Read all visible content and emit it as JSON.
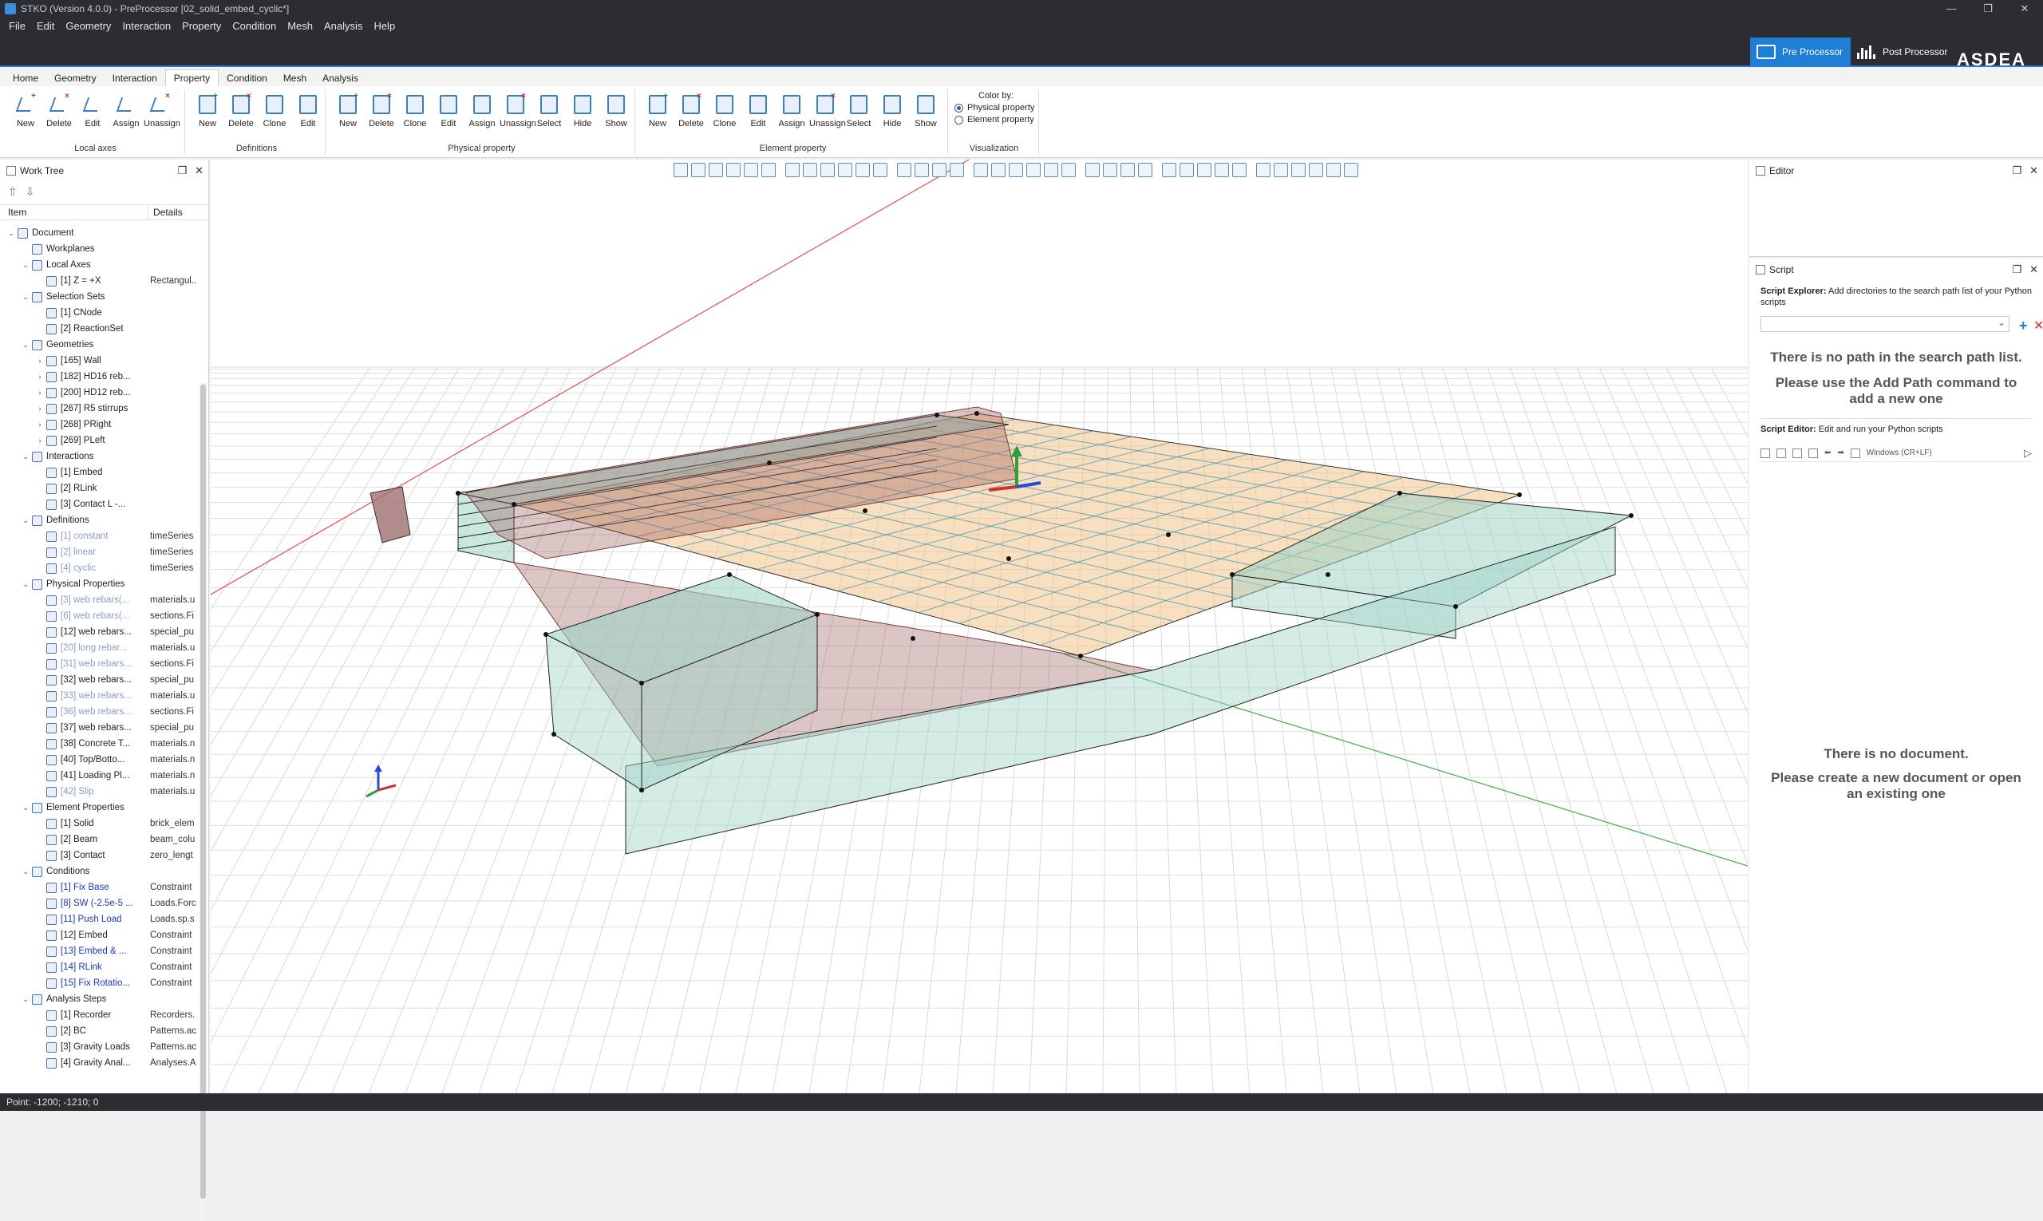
{
  "window": {
    "title": "STKO (Version 4.0.0) - PreProcessor [02_solid_embed_cyclic*]",
    "controls": [
      "—",
      "❐",
      "✕"
    ]
  },
  "menu": [
    "File",
    "Edit",
    "Geometry",
    "Interaction",
    "Property",
    "Condition",
    "Mesh",
    "Analysis",
    "Help"
  ],
  "modes": {
    "pre": "Pre Processor",
    "post": "Post Processor"
  },
  "brand": "ASDEA",
  "ribbon": {
    "tabs": [
      "Home",
      "Geometry",
      "Interaction",
      "Property",
      "Condition",
      "Mesh",
      "Analysis"
    ],
    "active_tab": "Property",
    "groups": [
      {
        "name": "Local axes",
        "buttons": [
          "New",
          "Delete",
          "Edit",
          "Assign",
          "Unassign"
        ]
      },
      {
        "name": "Definitions",
        "buttons": [
          "New",
          "Delete",
          "Clone",
          "Edit"
        ]
      },
      {
        "name": "Physical property",
        "buttons": [
          "New",
          "Delete",
          "Clone",
          "Edit",
          "Assign",
          "Unassign",
          "Select",
          "Hide",
          "Show"
        ]
      },
      {
        "name": "Element property",
        "buttons": [
          "New",
          "Delete",
          "Clone",
          "Edit",
          "Assign",
          "Unassign",
          "Select",
          "Hide",
          "Show"
        ]
      }
    ],
    "color_by": {
      "title": "Color by:",
      "options": [
        "Physical property",
        "Element property"
      ],
      "selected": "Physical property",
      "group_name": "Visualization"
    }
  },
  "worktree": {
    "title": "Work Tree",
    "col_item": "Item",
    "col_details": "Details",
    "rows": [
      {
        "label": "Document",
        "details": "",
        "level": 0,
        "state": ""
      },
      {
        "label": "Workplanes",
        "details": "",
        "level": 1,
        "state": ""
      },
      {
        "label": "Local Axes",
        "details": "",
        "level": 1,
        "state": ""
      },
      {
        "label": "[1] Z = +X",
        "details": "Rectangul...",
        "level": 2,
        "state": ""
      },
      {
        "label": "Selection Sets",
        "details": "",
        "level": 1,
        "state": ""
      },
      {
        "label": "[1] CNode",
        "details": "",
        "level": 2,
        "state": ""
      },
      {
        "label": "[2] ReactionSet",
        "details": "",
        "level": 2,
        "state": ""
      },
      {
        "label": "Geometries",
        "details": "",
        "level": 1,
        "state": ""
      },
      {
        "label": "[165] Wall",
        "details": "",
        "level": 2,
        "state": ""
      },
      {
        "label": "[182] HD16 reb...",
        "details": "",
        "level": 2,
        "state": ""
      },
      {
        "label": "[200] HD12 reb...",
        "details": "",
        "level": 2,
        "state": ""
      },
      {
        "label": "[267] R5 stirrups",
        "details": "",
        "level": 2,
        "state": ""
      },
      {
        "label": "[268] PRight",
        "details": "",
        "level": 2,
        "state": ""
      },
      {
        "label": "[269] PLeft",
        "details": "",
        "level": 2,
        "state": ""
      },
      {
        "label": "Interactions",
        "details": "",
        "level": 1,
        "state": ""
      },
      {
        "label": "[1] Embed",
        "details": "",
        "level": 2,
        "state": ""
      },
      {
        "label": "[2] RLink",
        "details": "",
        "level": 2,
        "state": ""
      },
      {
        "label": "[3] Contact L -...",
        "details": "",
        "level": 2,
        "state": ""
      },
      {
        "label": "Definitions",
        "details": "",
        "level": 1,
        "state": ""
      },
      {
        "label": "[1] constant",
        "details": "timeSeries",
        "level": 2,
        "state": "grey"
      },
      {
        "label": "[2] linear",
        "details": "timeSeries",
        "level": 2,
        "state": "grey"
      },
      {
        "label": "[4] cyclic",
        "details": "timeSeries",
        "level": 2,
        "state": "grey"
      },
      {
        "label": "Physical Properties",
        "details": "",
        "level": 1,
        "state": ""
      },
      {
        "label": "[3] web rebars(...",
        "details": "materials.u",
        "level": 2,
        "state": "grey"
      },
      {
        "label": "[6] web rebars(...",
        "details": "sections.Fi",
        "level": 2,
        "state": "grey"
      },
      {
        "label": "[12] web rebars...",
        "details": "special_pu",
        "level": 2,
        "state": ""
      },
      {
        "label": "[20] long rebar...",
        "details": "materials.u",
        "level": 2,
        "state": "grey"
      },
      {
        "label": "[31] web rebars...",
        "details": "sections.Fi",
        "level": 2,
        "state": "grey"
      },
      {
        "label": "[32] web rebars...",
        "details": "special_pu",
        "level": 2,
        "state": ""
      },
      {
        "label": "[33] web rebars...",
        "details": "materials.u",
        "level": 2,
        "state": "grey"
      },
      {
        "label": "[36] web rebars...",
        "details": "sections.Fi",
        "level": 2,
        "state": "grey"
      },
      {
        "label": "[37] web rebars...",
        "details": "special_pu",
        "level": 2,
        "state": ""
      },
      {
        "label": "[38] Concrete T...",
        "details": "materials.n",
        "level": 2,
        "state": ""
      },
      {
        "label": "[40] Top/Botto...",
        "details": "materials.n",
        "level": 2,
        "state": ""
      },
      {
        "label": "[41] Loading Pl...",
        "details": "materials.n",
        "level": 2,
        "state": ""
      },
      {
        "label": "[42] Slip",
        "details": "materials.u",
        "level": 2,
        "state": "grey"
      },
      {
        "label": "Element Properties",
        "details": "",
        "level": 1,
        "state": ""
      },
      {
        "label": "[1] Solid",
        "details": "brick_elem",
        "level": 2,
        "state": ""
      },
      {
        "label": "[2] Beam",
        "details": "beam_colu",
        "level": 2,
        "state": ""
      },
      {
        "label": "[3] Contact",
        "details": "zero_lengt",
        "level": 2,
        "state": ""
      },
      {
        "label": "Conditions",
        "details": "",
        "level": 1,
        "state": ""
      },
      {
        "label": "[1] Fix Base",
        "details": "Constraint",
        "level": 2,
        "state": "blue"
      },
      {
        "label": "[8] SW (-2.5e-5 ...",
        "details": "Loads.Forc",
        "level": 2,
        "state": "blue"
      },
      {
        "label": "[11] Push Load",
        "details": "Loads.sp.s",
        "level": 2,
        "state": "blue"
      },
      {
        "label": "[12] Embed",
        "details": "Constraint",
        "level": 2,
        "state": ""
      },
      {
        "label": "[13] Embed & ...",
        "details": "Constraint",
        "level": 2,
        "state": "blue"
      },
      {
        "label": "[14] RLink",
        "details": "Constraint",
        "level": 2,
        "state": "blue"
      },
      {
        "label": "[15] Fix Rotatio...",
        "details": "Constraint",
        "level": 2,
        "state": "blue"
      },
      {
        "label": "Analysis Steps",
        "details": "",
        "level": 1,
        "state": ""
      },
      {
        "label": "[1] Recorder",
        "details": "Recorders.",
        "level": 2,
        "state": ""
      },
      {
        "label": "[2] BC",
        "details": "Patterns.ac",
        "level": 2,
        "state": ""
      },
      {
        "label": "[3] Gravity Loads",
        "details": "Patterns.ac",
        "level": 2,
        "state": ""
      },
      {
        "label": "[4] Gravity Anal...",
        "details": "Analyses.A",
        "level": 2,
        "state": ""
      }
    ]
  },
  "editor": {
    "title": "Editor"
  },
  "script": {
    "title": "Script",
    "explorer_label": "Script Explorer:",
    "explorer_desc": "Add directories to the search path list of your Python scripts",
    "no_path_1": "There is no path in the search path list.",
    "no_path_2": "Please use the Add Path command to add a new one",
    "editor_label": "Script Editor:",
    "editor_desc": "Edit and run your Python scripts",
    "line_endings": "Windows (CR+LF)",
    "no_doc_1": "There is no document.",
    "no_doc_2": "Please create a new document or open an existing one"
  },
  "status": {
    "text": "Point: -1200; -1210; 0"
  },
  "colors": {
    "accent": "#1f7ed6",
    "dark_bar": "#2b2d33",
    "concrete": "#9fd3c7",
    "slab": "#f2c48a",
    "rebar": "#9a5a5a"
  }
}
